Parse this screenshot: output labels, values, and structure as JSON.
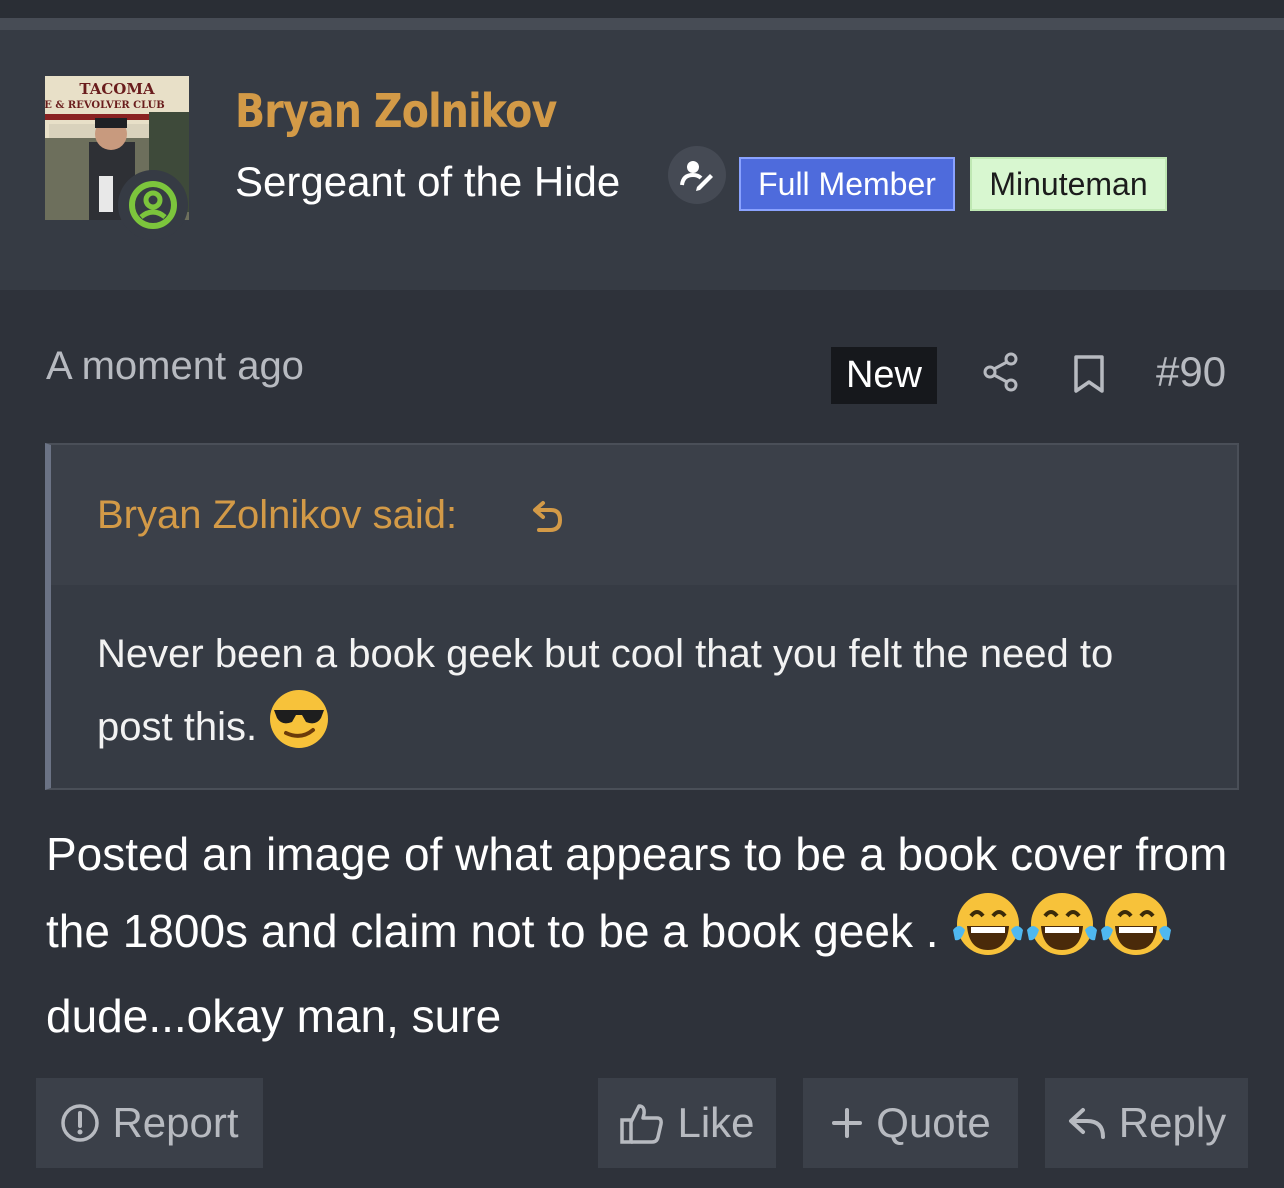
{
  "user": {
    "name": "Bryan Zolnikov",
    "rank": "Sergeant of the Hide",
    "badges": [
      "Full Member",
      "Minuteman"
    ],
    "avatar_sign_text": "TACOMA",
    "avatar_sign_line2": "LE & REVOLVER CLUB"
  },
  "post": {
    "timestamp": "A moment ago",
    "new_label": "New",
    "post_number": "#90",
    "quote": {
      "author_said": "Bryan Zolnikov said:",
      "text": "Never been a book geek but cool that you felt the need to post this."
    },
    "body_part1": "Posted an image of what appears to be a book cover from the 1800s and claim not to be a book geek .",
    "body_part2": "dude...okay man, sure"
  },
  "actions": {
    "report": "Report",
    "like": "Like",
    "quote": "Quote",
    "reply": "Reply"
  },
  "colors": {
    "accent_gold": "#d39a47",
    "full_member_bg": "#4e6bdc",
    "minuteman_bg": "#d8f7d0",
    "status_green": "#7cc53c"
  }
}
